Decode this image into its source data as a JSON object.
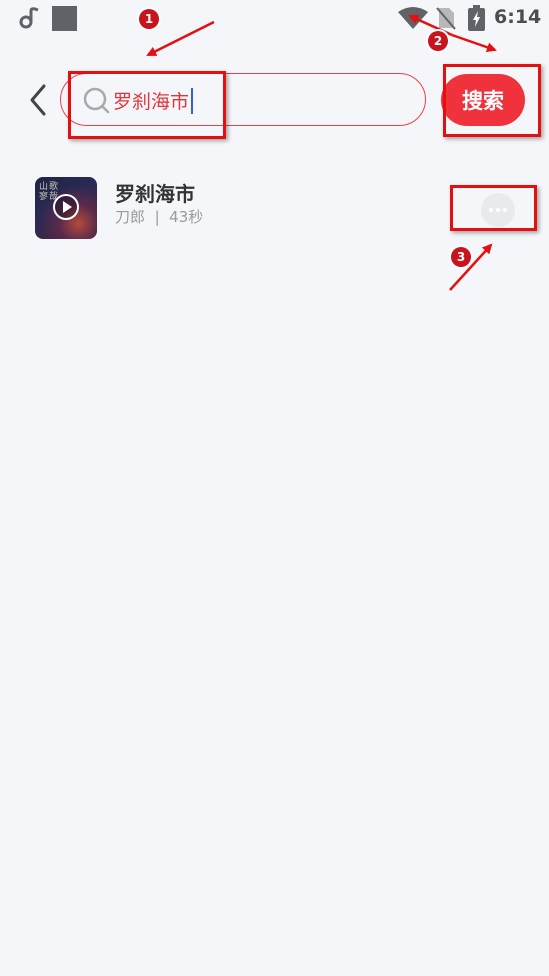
{
  "status_bar": {
    "time": "6:14",
    "icons": [
      "app-notification-icon",
      "square-notification-icon",
      "wifi-icon",
      "no-sim-icon",
      "battery-charging-icon"
    ]
  },
  "search": {
    "query": "罗刹海市",
    "button_label": "搜索",
    "accent_color": "#f0323c"
  },
  "results": [
    {
      "title": "罗刹海市",
      "artist": "刀郎",
      "separator": "|",
      "duration": "43秒",
      "cover_text": "山歌寥哉"
    }
  ],
  "annotations": [
    {
      "number": "1"
    },
    {
      "number": "2"
    },
    {
      "number": "3"
    }
  ]
}
